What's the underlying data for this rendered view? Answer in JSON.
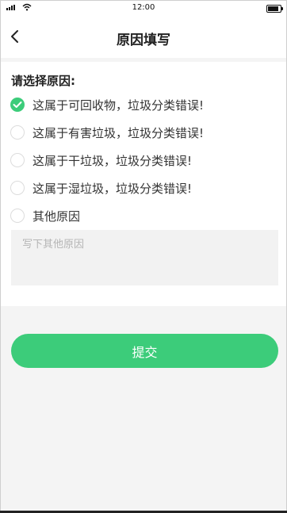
{
  "status_bar": {
    "time": "12:00"
  },
  "nav": {
    "title": "原因填写",
    "back_icon": "chevron-left-icon"
  },
  "form": {
    "prompt": "请选择原因:",
    "options": [
      {
        "label": "这属于可回收物，垃圾分类错误!",
        "selected": true
      },
      {
        "label": "这属于有害垃圾，垃圾分类错误!",
        "selected": false
      },
      {
        "label": "这属于干垃圾，垃圾分类错误!",
        "selected": false
      },
      {
        "label": "这属于湿垃圾，垃圾分类错误!",
        "selected": false
      },
      {
        "label": "其他原因",
        "selected": false
      }
    ],
    "other_reason": {
      "value": "",
      "placeholder": "写下其他原因"
    },
    "submit_label": "提交"
  },
  "colors": {
    "accent": "#3ccc7a",
    "input_bg": "#f2f2f2",
    "page_bg": "#f4f4f4"
  }
}
